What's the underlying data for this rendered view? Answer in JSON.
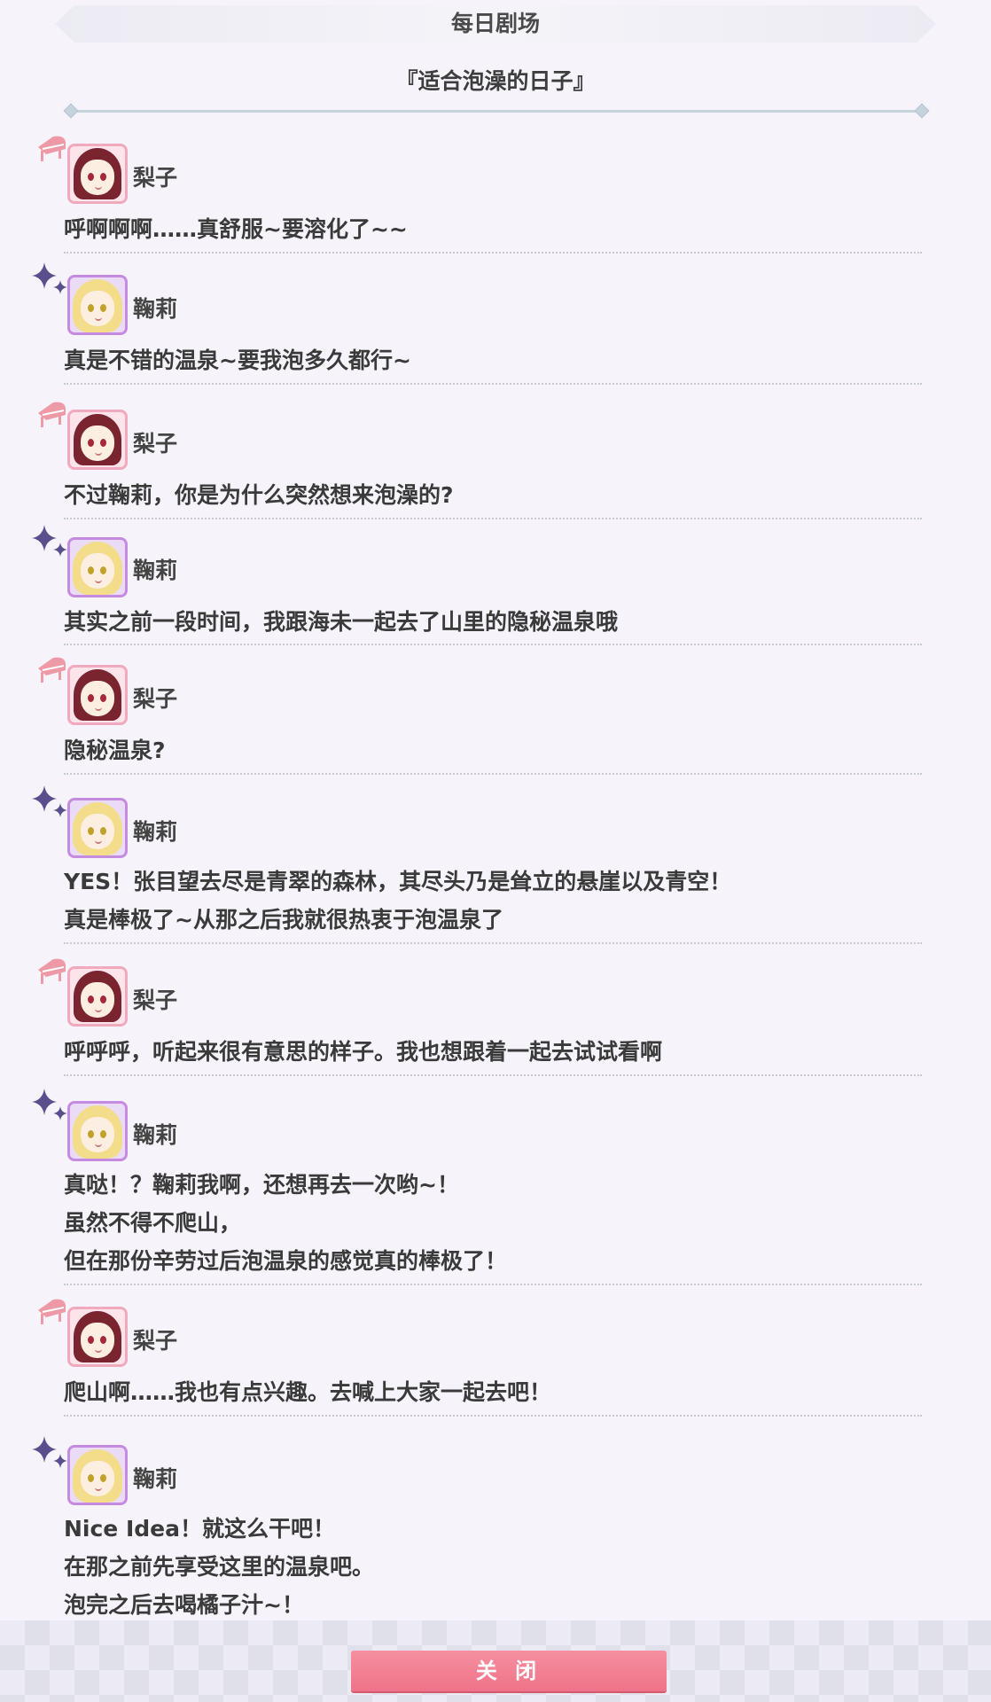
{
  "header": {
    "title": "每日剧场"
  },
  "story": {
    "title": "『适合泡澡的日子』"
  },
  "dialogue": [
    {
      "speaker": "梨子",
      "lines": [
        "呼啊啊啊……真舒服~要溶化了~~"
      ]
    },
    {
      "speaker": "鞠莉",
      "lines": [
        "真是不错的温泉~要我泡多久都行~"
      ]
    },
    {
      "speaker": "梨子",
      "lines": [
        "不过鞠莉，你是为什么突然想来泡澡的?"
      ]
    },
    {
      "speaker": "鞠莉",
      "lines": [
        "其实之前一段时间，我跟海未一起去了山里的隐秘温泉哦"
      ]
    },
    {
      "speaker": "梨子",
      "lines": [
        "隐秘温泉?"
      ]
    },
    {
      "speaker": "鞠莉",
      "lines": [
        "YES！张目望去尽是青翠的森林，其尽头乃是耸立的悬崖以及青空！",
        "真是棒极了~从那之后我就很热衷于泡温泉了"
      ]
    },
    {
      "speaker": "梨子",
      "lines": [
        "呼呼呼，听起来很有意思的样子。我也想跟着一起去试试看啊"
      ]
    },
    {
      "speaker": "鞠莉",
      "lines": [
        "真哒！？鞠莉我啊，还想再去一次哟~！",
        "虽然不得不爬山，",
        "但在那份辛劳过后泡温泉的感觉真的棒极了！"
      ]
    },
    {
      "speaker": "梨子",
      "lines": [
        "爬山啊……我也有点兴趣。去喊上大家一起去吧！"
      ]
    },
    {
      "speaker": "鞠莉",
      "lines": [
        "Nice Idea！就这么干吧！",
        "在那之前先享受这里的温泉吧。",
        "泡完之后去喝橘子汁~！"
      ]
    }
  ],
  "footer": {
    "close_label": "关 闭"
  },
  "colors": {
    "riko_accent": "#f1a9bd",
    "mari_accent": "#c58be0",
    "close_button": "#ef7388",
    "sparkle": "#5a4f8c",
    "piano": "#ee9aa6"
  },
  "icons": {
    "riko_decor": "piano-icon",
    "mari_decor": "sparkle-icon"
  }
}
